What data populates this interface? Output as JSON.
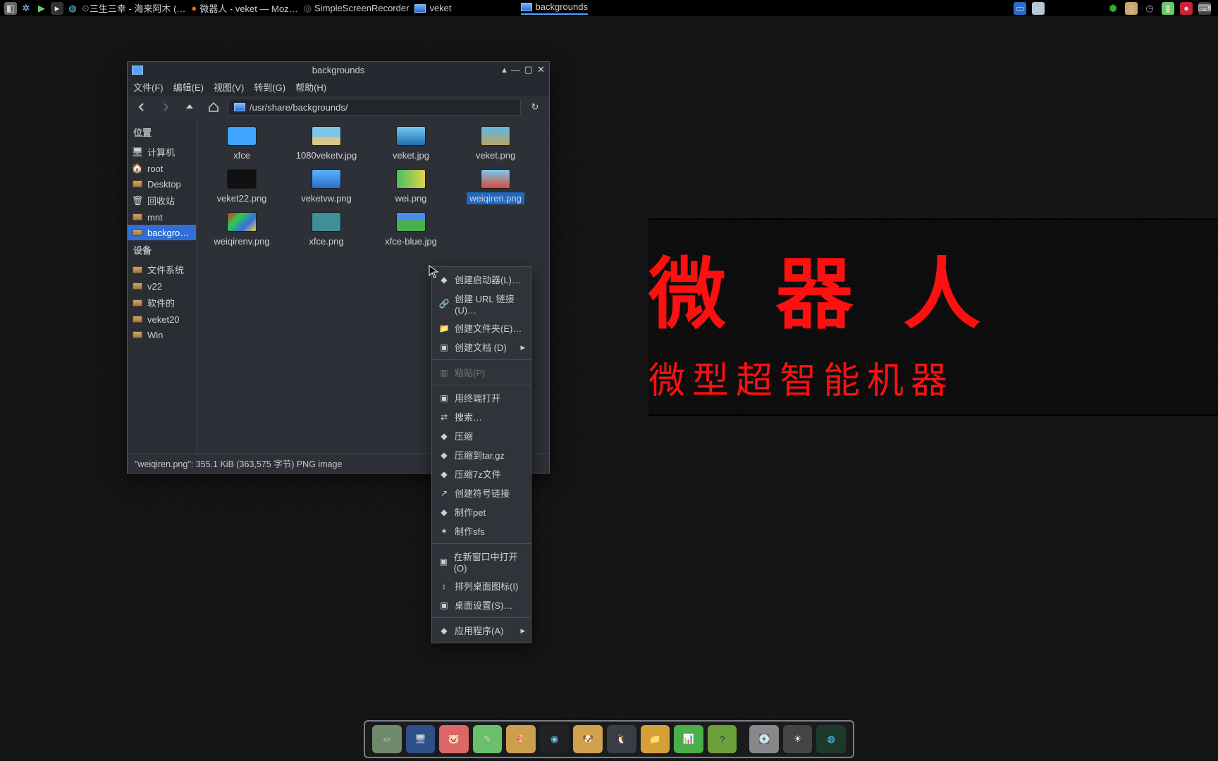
{
  "taskbar": {
    "apps": [
      {
        "label": "三生三幸 - 海来阿木 (…"
      },
      {
        "label": "微器人 - veket — Moz…"
      },
      {
        "label": "SimpleScreenRecorder"
      },
      {
        "label": "veket"
      },
      {
        "label": "backgrounds"
      }
    ]
  },
  "wallpaper": {
    "title": "微 器 人",
    "subtitle": "微型超智能机器"
  },
  "fm": {
    "title": "backgrounds",
    "menu": {
      "file": "文件(F)",
      "edit": "编辑(E)",
      "view": "视图(V)",
      "go": "转到(G)",
      "help": "帮助(H)"
    },
    "path": "/usr/share/backgrounds/",
    "side_places": "位置",
    "side_items": [
      {
        "label": "计算机",
        "icon": "computer"
      },
      {
        "label": "root",
        "icon": "home"
      },
      {
        "label": "Desktop",
        "icon": "folder"
      },
      {
        "label": "回收站",
        "icon": "trash"
      },
      {
        "label": "mnt",
        "icon": "folder"
      },
      {
        "label": "backgro…",
        "icon": "folder",
        "sel": true
      }
    ],
    "side_devices": "设备",
    "side_dev_items": [
      {
        "label": "文件系统"
      },
      {
        "label": "v22"
      },
      {
        "label": "软件的"
      },
      {
        "label": "veket20"
      },
      {
        "label": "Win"
      }
    ],
    "files": [
      {
        "name": "xfce",
        "color": "#3fa3ff",
        "folder": true
      },
      {
        "name": "1080veketv.jpg",
        "color": "linear-gradient(to bottom,#7ec5e8 55%,#d9c48a 55%)"
      },
      {
        "name": "veket.jpg",
        "color": "linear-gradient(to bottom,#75c9f0,#1f6fb4)"
      },
      {
        "name": "veket.png",
        "color": "linear-gradient(to bottom,#5fb5e8,#b7a864)"
      },
      {
        "name": "veket22.png",
        "color": "#111"
      },
      {
        "name": "veketvw.png",
        "color": "linear-gradient(to bottom,#5ab4ff,#2b6cc8)"
      },
      {
        "name": "wei.png",
        "color": "linear-gradient(to right,#47c060,#e2d24a)"
      },
      {
        "name": "weiqiren.png",
        "color": "linear-gradient(to bottom,#7cc8f0,#d94b3b)",
        "sel": true
      },
      {
        "name": "weiqirenv.png",
        "color": "linear-gradient(135deg,#d62e2e,#2ecb4e,#346ede,#f2d23a)"
      },
      {
        "name": "xfce.png",
        "color": "#3f8f96"
      },
      {
        "name": "xfce-blue.jpg",
        "color": "linear-gradient(to bottom,#4a8de8 40%,#49b04e 40%)"
      }
    ],
    "status": "\"weiqiren.png\": 355.1 KiB (363,575 字节) PNG image"
  },
  "ctx": {
    "items": [
      {
        "label": "创建启动器(L)…",
        "icon": "◆"
      },
      {
        "label": "创建 URL 链接(U)…",
        "icon": "🔗"
      },
      {
        "label": "创建文件夹(E)…",
        "icon": "📁"
      },
      {
        "label": "创建文档 (D)",
        "icon": "▣",
        "submenu": true
      },
      {
        "sep": true
      },
      {
        "label": "粘贴(P)",
        "icon": "▥",
        "disabled": true
      },
      {
        "sep": true
      },
      {
        "label": "用终端打开",
        "icon": "▣"
      },
      {
        "label": "搜索…",
        "icon": "⇄"
      },
      {
        "label": "压缩",
        "icon": "◆"
      },
      {
        "label": "压缩到tar.gz",
        "icon": "◆"
      },
      {
        "label": "压缩7z文件",
        "icon": "◆"
      },
      {
        "label": "创建符号链接",
        "icon": "↗"
      },
      {
        "label": "制作pet",
        "icon": "◆"
      },
      {
        "label": "制作sfs",
        "icon": "✶"
      },
      {
        "sep": true
      },
      {
        "label": "在新窗口中打开(O)",
        "icon": "▣"
      },
      {
        "label": "排列桌面图标(I)",
        "icon": "↕"
      },
      {
        "label": "桌面设置(S)…",
        "icon": "▣"
      },
      {
        "sep": true
      },
      {
        "label": "应用程序(A)",
        "icon": "◆",
        "submenu": true
      }
    ]
  }
}
